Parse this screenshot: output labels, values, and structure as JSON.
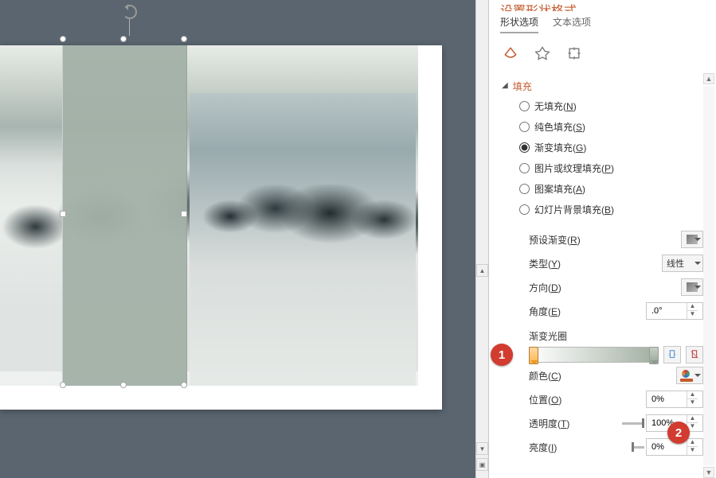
{
  "panel": {
    "title": "设置形状格式",
    "tabs": {
      "shape": "形状选项",
      "text": "文本选项"
    },
    "section_fill": "填充",
    "fill_options": {
      "none": {
        "label": "无填充",
        "key": "N"
      },
      "solid": {
        "label": "纯色填充",
        "key": "S"
      },
      "gradient": {
        "label": "渐变填充",
        "key": "G"
      },
      "picture": {
        "label": "图片或纹理填充",
        "key": "P"
      },
      "pattern": {
        "label": "图案填充",
        "key": "A"
      },
      "slidebg": {
        "label": "幻灯片背景填充",
        "key": "B"
      }
    },
    "rows": {
      "preset": {
        "label": "预设渐变",
        "key": "R"
      },
      "type": {
        "label": "类型",
        "key": "Y",
        "value": "线性"
      },
      "direction": {
        "label": "方向",
        "key": "D"
      },
      "angle": {
        "label": "角度",
        "key": "E",
        "value": ".0°"
      },
      "stops": {
        "label": "渐变光圈"
      },
      "color": {
        "label": "颜色",
        "key": "C"
      },
      "position": {
        "label": "位置",
        "key": "O",
        "value": "0%"
      },
      "transparency": {
        "label": "透明度",
        "key": "T",
        "value": "100%"
      },
      "brightness": {
        "label": "亮度",
        "key": "I",
        "value": "0%"
      }
    }
  },
  "badges": {
    "one": "1",
    "two": "2"
  }
}
